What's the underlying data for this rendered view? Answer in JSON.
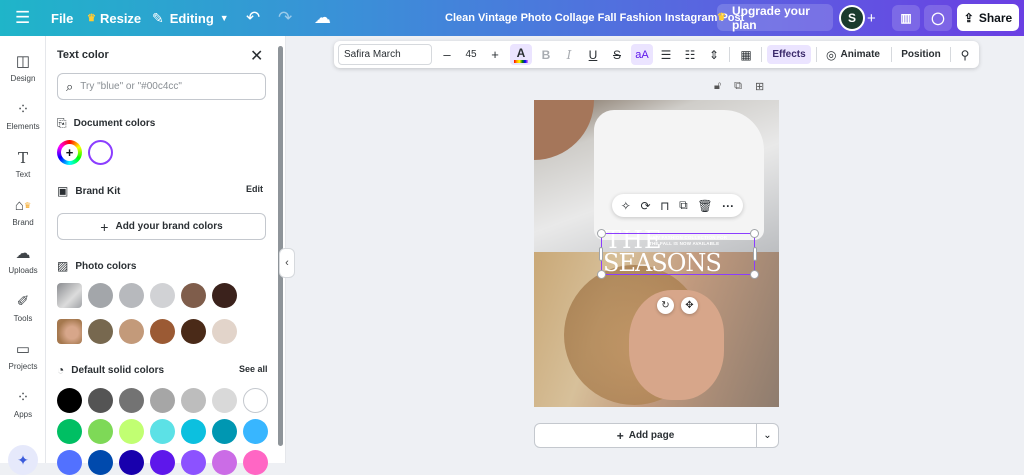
{
  "topbar": {
    "menu_icon": "hamburger-menu-icon",
    "file": "File",
    "resize": "Resize",
    "resize_icon": "crown-icon",
    "editing": "Editing",
    "doc_title": "Clean Vintage Photo Collage Fall Fashion Instagram Post",
    "upgrade": "Upgrade your plan",
    "avatar_initial": "S",
    "share": "Share",
    "colors": {
      "gradient_start": "#1fb5c9",
      "gradient_end": "#6a3fe3",
      "avatar_bg": "#1a3b2d"
    }
  },
  "rail": {
    "items": [
      {
        "label": "Design",
        "icon": "design-icon"
      },
      {
        "label": "Elements",
        "icon": "elements-icon"
      },
      {
        "label": "Text",
        "icon": "text-icon"
      },
      {
        "label": "Brand",
        "icon": "brand-icon"
      },
      {
        "label": "Uploads",
        "icon": "uploads-icon"
      },
      {
        "label": "Tools",
        "icon": "tools-icon"
      },
      {
        "label": "Projects",
        "icon": "projects-icon"
      },
      {
        "label": "Apps",
        "icon": "apps-icon"
      }
    ]
  },
  "panel": {
    "title": "Text color",
    "search_placeholder": "Try \"blue\" or \"#00c4cc\"",
    "document_colors": "Document colors",
    "brand_kit": "Brand Kit",
    "brand_edit": "Edit",
    "add_brand": "Add your brand colors",
    "photo_colors": "Photo colors",
    "default_colors": "Default solid colors",
    "see_all": "See all",
    "photo_row1": [
      "#a3a6aa",
      "#b7b9bd",
      "#d1d2d5",
      "#7f5d4b",
      "#3b221c"
    ],
    "photo_row2": [
      "#77684f",
      "#c39a7a",
      "#9b5a34",
      "#4a2a18",
      "#e2d4ca"
    ],
    "default_row1": [
      "#000000",
      "#545454",
      "#737373",
      "#a6a6a6",
      "#bdbdbd",
      "#d9d9d9",
      "#ffffff"
    ],
    "default_row2": [
      "#00bf63",
      "#7ed957",
      "#c1ff72",
      "#5ce1e6",
      "#0cc0df",
      "#0097b2",
      "#38b6ff"
    ],
    "default_row3": [
      "#5271ff",
      "#004aad",
      "#1800ad",
      "#5e17eb",
      "#8c52ff",
      "#cb6ce6",
      "#ff66c4"
    ]
  },
  "editor_toolbar": {
    "font": "Safira March",
    "size": "45",
    "effects": "Effects",
    "animate": "Animate",
    "position": "Position",
    "text_color_swatch": "#8b3dff"
  },
  "canvas": {
    "headline_1": "THE",
    "headline_2": "SEASONS",
    "tagline_1": "NEW FASHION COLLECTION FOR",
    "tagline_2": "THE FALL IS NOW AVAILABLE",
    "add_page": "Add page",
    "selection_color": "#8b3dff"
  }
}
